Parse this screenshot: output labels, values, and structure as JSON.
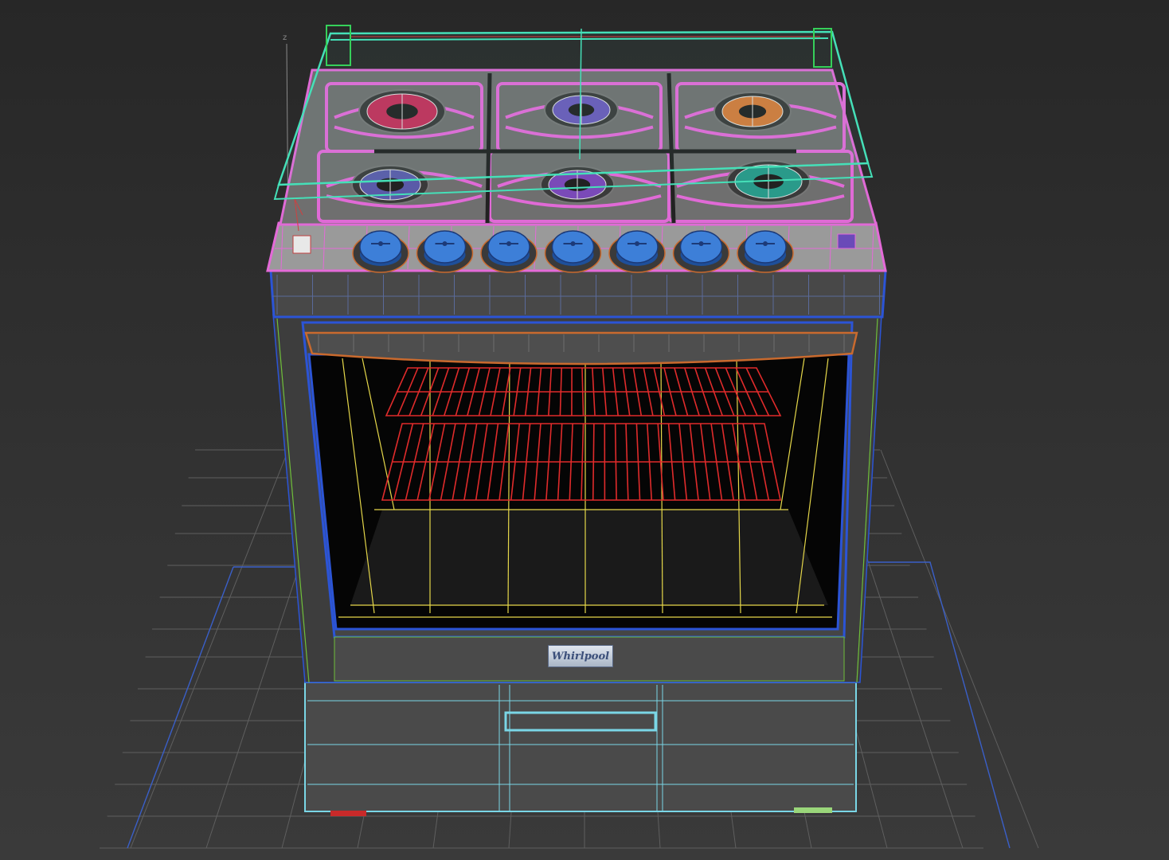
{
  "viewport": {
    "background": "#2e2e2e",
    "axis_label": "z",
    "display_mode": "wireframe-over-shaded"
  },
  "stove": {
    "brand_label": "Whirlpool",
    "burner_count": 6,
    "knob_count": 7,
    "oven_rack_count": 2,
    "storage_drawer_count": 1
  },
  "wire_colors": {
    "floor_grid": "#5f5f5f",
    "lid": "#45e0b8",
    "lid_frame": "#36d05a",
    "cooktop": "#e06ad6",
    "control_panel": "#e46ad8",
    "knobs": "#3d7fd8",
    "door_frame": "#2b54d6",
    "door_handle": "#c96a2e",
    "oven_racks": "#e02b2b",
    "oven_interior": "#e6d84a",
    "drawer": "#7ad6e6",
    "side_panel": "#6fbf3a"
  },
  "burner_colors": [
    "#c0305a",
    "#6a5ab8",
    "#d07a3a",
    "#5a5aa8",
    "#7a4ab8",
    "#2a9a8a"
  ]
}
